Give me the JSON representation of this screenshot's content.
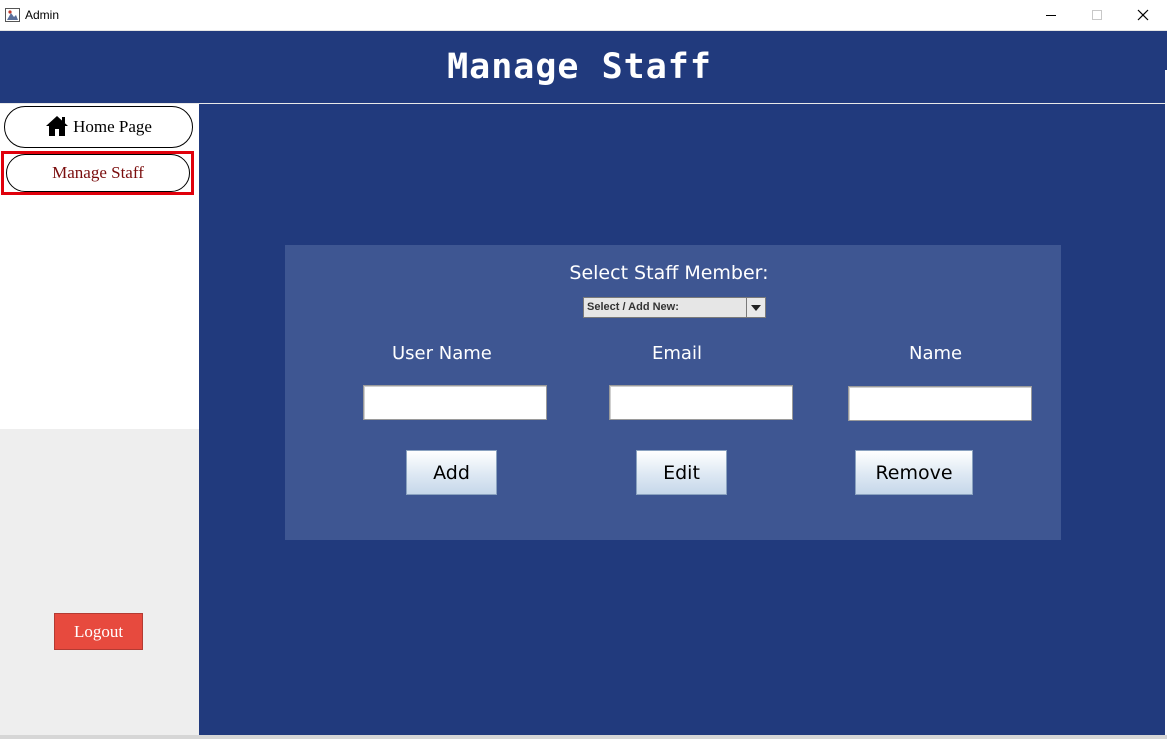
{
  "window": {
    "title": "Admin",
    "controls": {
      "minimize": "minimize-icon",
      "maximize": "maximize-icon",
      "close": "close-icon"
    }
  },
  "header": {
    "title": "Manage Staff"
  },
  "sidebar": {
    "items": [
      {
        "label": "Home Page",
        "icon": "home-icon"
      },
      {
        "label": "Manage Staff",
        "selected": true
      }
    ],
    "logout_label": "Logout"
  },
  "form": {
    "select_label": "Select Staff Member:",
    "select_value": "Select / Add New:",
    "fields": {
      "username": {
        "label": "User Name",
        "value": ""
      },
      "email": {
        "label": "Email",
        "value": ""
      },
      "name": {
        "label": "Name",
        "value": ""
      }
    },
    "buttons": {
      "add": "Add",
      "edit": "Edit",
      "remove": "Remove"
    }
  },
  "colors": {
    "header_bg": "#213a7d",
    "panel_bg": "#3e5692",
    "selected_outline": "#e0000b",
    "logout_bg": "#e74a3e"
  }
}
